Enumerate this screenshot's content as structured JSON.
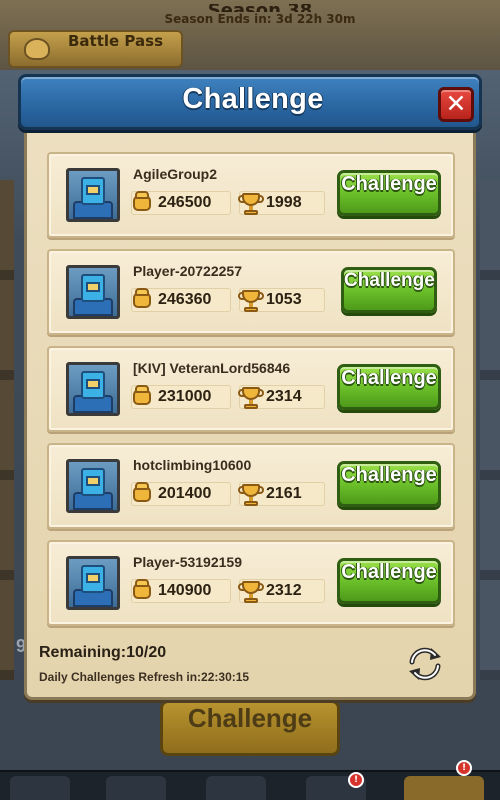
{
  "background": {
    "season_title": "Season 38",
    "season_ends": "Season Ends in: 3d 22h 30m",
    "battle_pass_label": "Battle Pass",
    "bottom_button_label": "Challenge",
    "partial_left_text": "9"
  },
  "modal": {
    "title": "Challenge",
    "close_icon": "close-x-icon",
    "colors": {
      "header_blue": "#2b68a4",
      "challenge_green": "#6cc02a",
      "close_red": "#d6332c",
      "panel_beige": "#ecdfc0"
    }
  },
  "opponents": [
    {
      "name": "AgileGroup2",
      "power": "246500",
      "trophies": "1998",
      "button_label": "Challenge"
    },
    {
      "name": "Player-20722257",
      "power": "246360",
      "trophies": "1053",
      "button_label": "Challenge"
    },
    {
      "name": "[KIV] VeteranLord56846",
      "power": "231000",
      "trophies": "2314",
      "button_label": "Challenge"
    },
    {
      "name": "hotclimbing10600",
      "power": "201400",
      "trophies": "2161",
      "button_label": "Challenge"
    },
    {
      "name": "Player-53192159",
      "power": "140900",
      "trophies": "2312",
      "button_label": "Challenge"
    }
  ],
  "footer": {
    "remaining": "Remaining:10/20",
    "refresh_text": "Daily Challenges Refresh in:22:30:15",
    "refresh_icon": "refresh-icon"
  },
  "nav": {
    "badges": [
      "!",
      "!"
    ]
  }
}
